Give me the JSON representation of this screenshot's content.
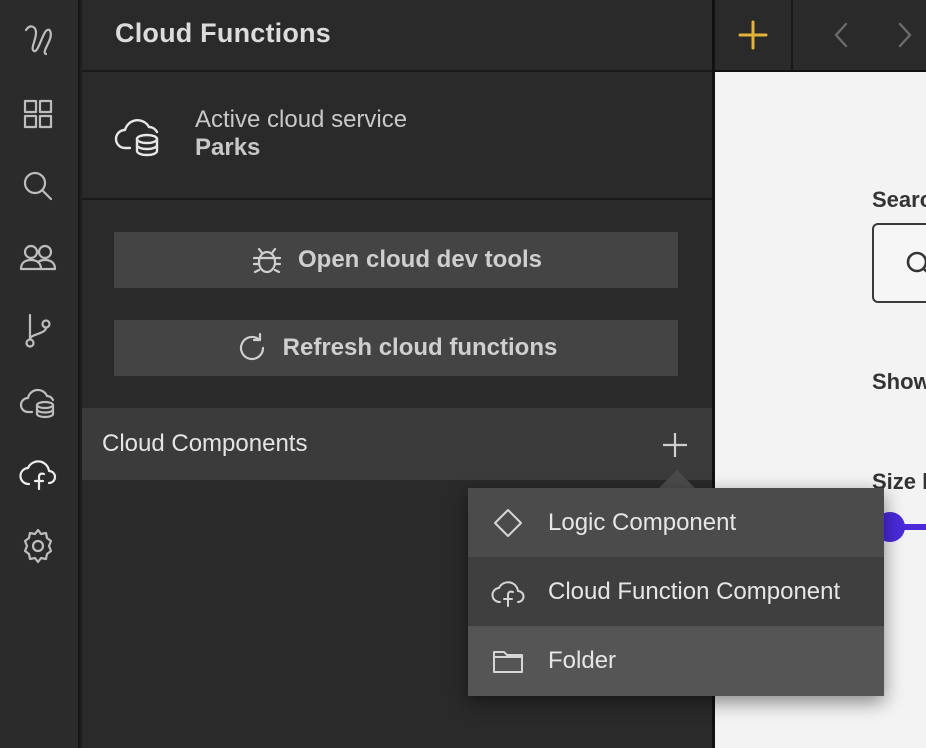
{
  "sidebar": {
    "icons": [
      "logo-icon",
      "components-grid-icon",
      "search-icon",
      "users-icon",
      "branch-icon",
      "cloud-database-icon",
      "cloud-function-icon",
      "settings-icon"
    ],
    "active": "cloud-function-icon"
  },
  "panel": {
    "title": "Cloud Functions",
    "service_label": "Active cloud service",
    "service_name": "Parks",
    "dev_tools_label": "Open cloud dev tools",
    "refresh_label": "Refresh cloud functions",
    "section_label": "Cloud Components"
  },
  "menu": {
    "items": [
      {
        "label": "Logic Component",
        "icon": "diamond-icon"
      },
      {
        "label": "Cloud Function Component",
        "icon": "cloud-function-icon"
      },
      {
        "label": "Folder",
        "icon": "folder-icon"
      }
    ]
  },
  "canvas": {
    "search_label": "Searc",
    "show_label": "Show",
    "size_label": "Size l"
  },
  "colors": {
    "accent_add": "#e2b33b",
    "slider": "#4a2ad9",
    "panel_bg": "#2a2a2a"
  }
}
